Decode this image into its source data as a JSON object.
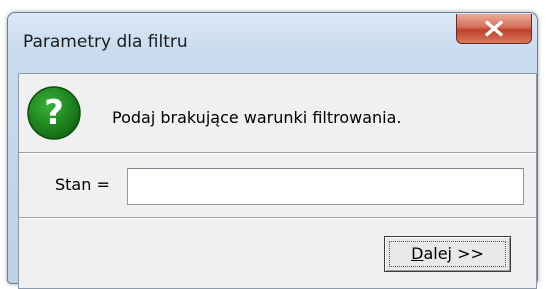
{
  "window": {
    "title": "Parametry dla filtru",
    "close_icon": "close-icon"
  },
  "dialog": {
    "icon": "question-icon",
    "icon_glyph": "?",
    "message": "Podaj brakujące warunki filtrowania.",
    "field_label": "Stan =",
    "field_value": "",
    "button_mnemonic": "D",
    "button_rest": "alej >>"
  },
  "colors": {
    "icon_green": "#1f8a1f",
    "close_red": "#c9422b"
  }
}
